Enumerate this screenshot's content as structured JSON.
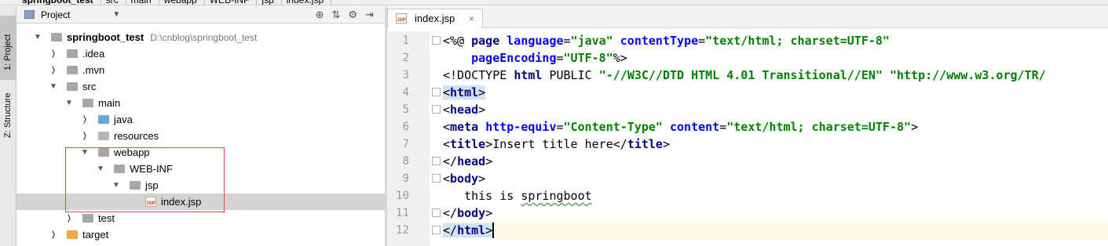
{
  "breadcrumb": [
    "springboot_test",
    "src",
    "main",
    "webapp",
    "WEB-INF",
    "jsp",
    "index.jsp"
  ],
  "toolstrip": {
    "project_tab": "1: Project",
    "structure_tab": "Z: Structure"
  },
  "panel": {
    "title": "Project",
    "icons": [
      "target-icon",
      "collapse-all-icon",
      "gear-icon",
      "hide-icon"
    ]
  },
  "tree": [
    {
      "label": "springboot_test",
      "path": "D:\\cnblog\\springboot_test",
      "depth": 0,
      "arrow": "down",
      "icon": "module",
      "bold": true
    },
    {
      "label": ".idea",
      "depth": 1,
      "arrow": "right",
      "icon": "folder"
    },
    {
      "label": ".mvn",
      "depth": 1,
      "arrow": "right",
      "icon": "folder"
    },
    {
      "label": "src",
      "depth": 1,
      "arrow": "down",
      "icon": "folder"
    },
    {
      "label": "main",
      "depth": 2,
      "arrow": "down",
      "icon": "folder"
    },
    {
      "label": "java",
      "depth": 3,
      "arrow": "right",
      "icon": "source-folder"
    },
    {
      "label": "resources",
      "depth": 3,
      "arrow": "right",
      "icon": "resources-folder"
    },
    {
      "label": "webapp",
      "depth": 3,
      "arrow": "down",
      "icon": "folder"
    },
    {
      "label": "WEB-INF",
      "depth": 4,
      "arrow": "down",
      "icon": "folder"
    },
    {
      "label": "jsp",
      "depth": 5,
      "arrow": "down",
      "icon": "folder"
    },
    {
      "label": "index.jsp",
      "depth": 6,
      "arrow": "none",
      "icon": "jsp-file",
      "selected": true
    },
    {
      "label": "test",
      "depth": 2,
      "arrow": "right",
      "icon": "folder"
    },
    {
      "label": "target",
      "depth": 1,
      "arrow": "right",
      "icon": "excluded-folder"
    }
  ],
  "editor": {
    "tab_label": "index.jsp",
    "file_icon_text": "JSP",
    "close_glyph": "×",
    "current_line": 12,
    "line_numbers": [
      "1",
      "2",
      "3",
      "4",
      "5",
      "6",
      "7",
      "8",
      "9",
      "10",
      "11",
      "12"
    ],
    "lines": [
      [
        [
          "plain",
          "<%@ "
        ],
        [
          "tag",
          "page "
        ],
        [
          "attr",
          "language"
        ],
        [
          "plain",
          "="
        ],
        [
          "str",
          "\"java\""
        ],
        [
          "plain",
          " "
        ],
        [
          "attr",
          "contentType"
        ],
        [
          "plain",
          "="
        ],
        [
          "str",
          "\"text/html; charset=UTF-8\""
        ]
      ],
      [
        [
          "plain",
          "    "
        ],
        [
          "attr",
          "pageEncoding"
        ],
        [
          "plain",
          "="
        ],
        [
          "str",
          "\"UTF-8\""
        ],
        [
          "plain",
          "%>"
        ]
      ],
      [
        [
          "plain",
          "<!DOCTYPE "
        ],
        [
          "tag",
          "html "
        ],
        [
          "plain",
          "PUBLIC "
        ],
        [
          "str",
          "\"-//W3C//DTD HTML 4.01 Transitional//EN\" \"http://www.w3.org/TR/"
        ]
      ],
      [
        [
          "match",
          "<"
        ],
        [
          "tagm",
          "html"
        ],
        [
          "match",
          ">"
        ]
      ],
      [
        [
          "plain",
          "<"
        ],
        [
          "tag",
          "head"
        ],
        [
          "plain",
          ">"
        ]
      ],
      [
        [
          "plain",
          "<"
        ],
        [
          "tag",
          "meta "
        ],
        [
          "attr",
          "http-equiv"
        ],
        [
          "plain",
          "="
        ],
        [
          "str",
          "\"Content-Type\""
        ],
        [
          "plain",
          " "
        ],
        [
          "attr",
          "content"
        ],
        [
          "plain",
          "="
        ],
        [
          "str",
          "\"text/html; charset=UTF-8\""
        ],
        [
          "plain",
          ">"
        ]
      ],
      [
        [
          "plain",
          "<"
        ],
        [
          "tag",
          "title"
        ],
        [
          "plain",
          ">Insert title here</"
        ],
        [
          "tag",
          "title"
        ],
        [
          "plain",
          ">"
        ]
      ],
      [
        [
          "plain",
          "</"
        ],
        [
          "tag",
          "head"
        ],
        [
          "plain",
          ">"
        ]
      ],
      [
        [
          "plain",
          "<"
        ],
        [
          "tag",
          "body"
        ],
        [
          "plain",
          ">"
        ]
      ],
      [
        [
          "plain",
          "   this is "
        ],
        [
          "squig",
          "springboot"
        ]
      ],
      [
        [
          "plain",
          "</"
        ],
        [
          "tag",
          "body"
        ],
        [
          "plain",
          ">"
        ]
      ],
      [
        [
          "match",
          "</"
        ],
        [
          "tagm",
          "html"
        ],
        [
          "match",
          ">"
        ]
      ]
    ]
  }
}
